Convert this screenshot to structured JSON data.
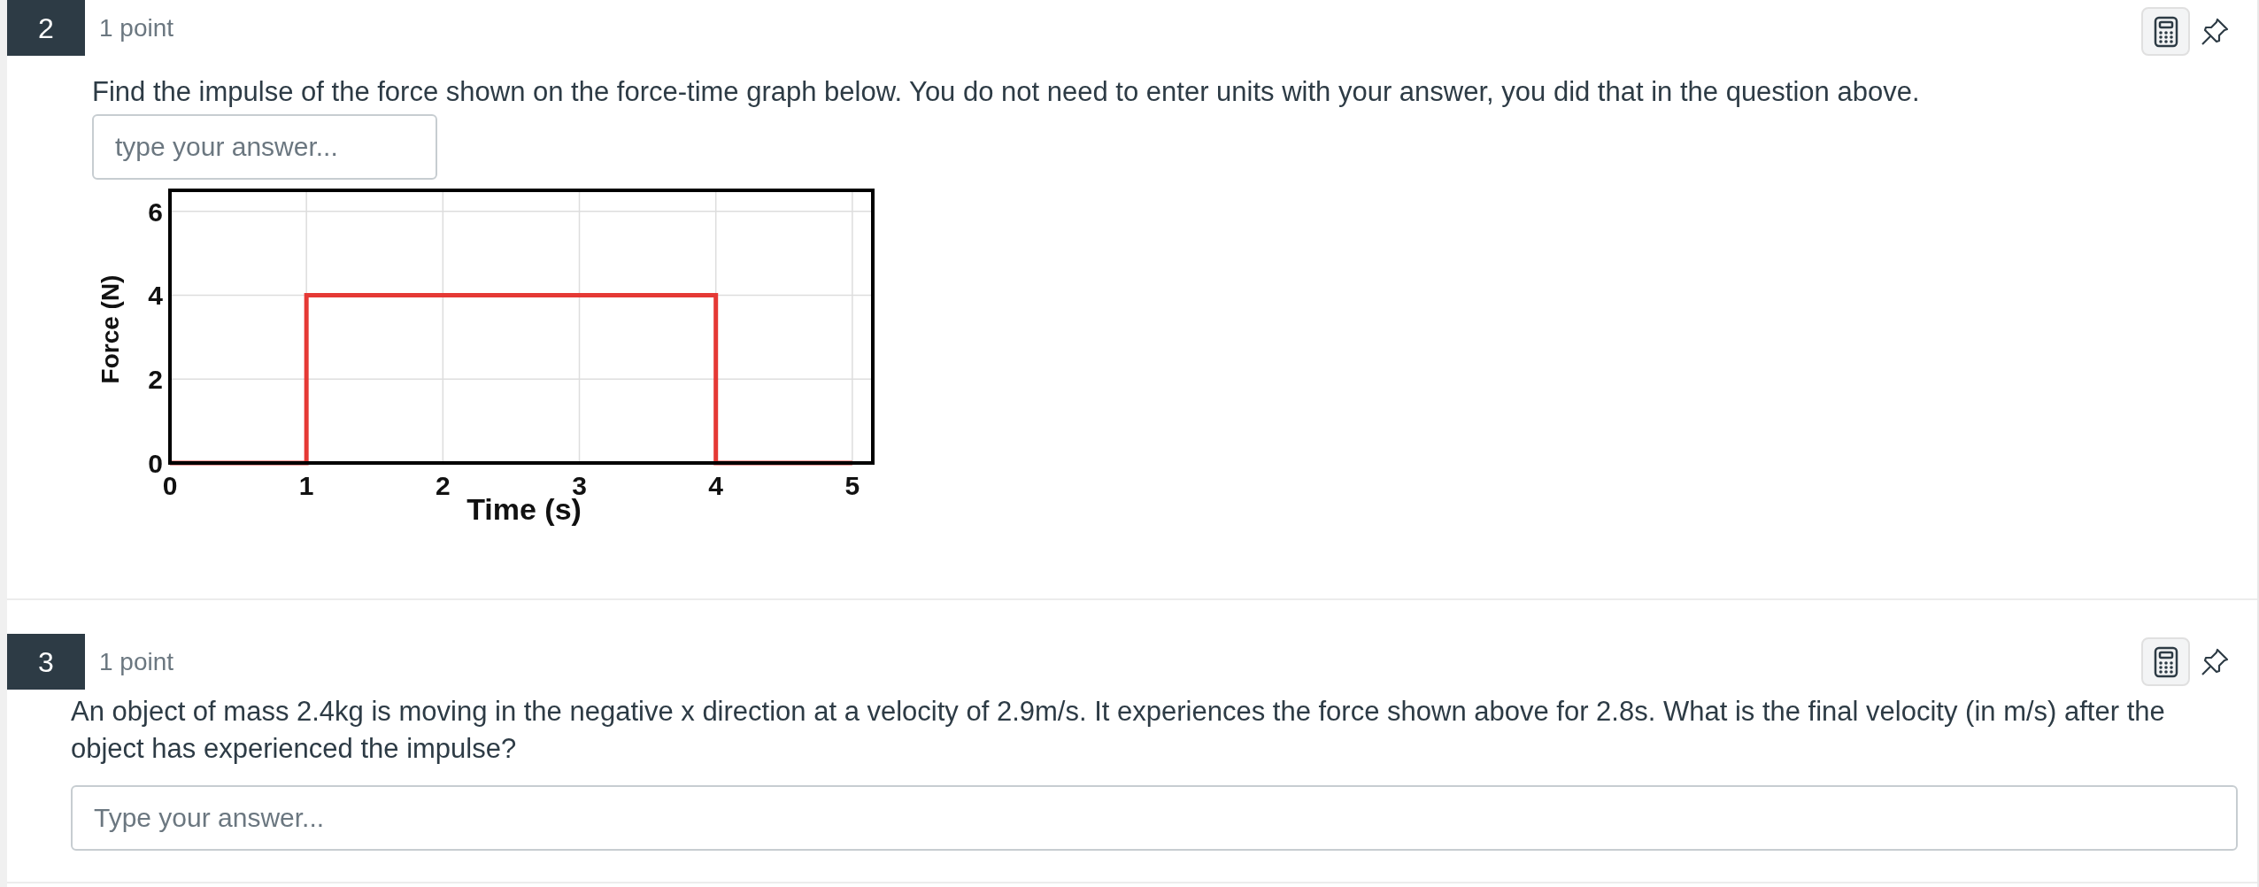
{
  "questions": [
    {
      "number": "2",
      "points": "1 point",
      "text": "Find the impulse of the force shown on the force-time graph below. You do not need to enter units with your answer, you did that in the question above.",
      "answer": {
        "placeholder": "type your answer..."
      },
      "chart_data": {
        "type": "line",
        "xlabel": "Time (s)",
        "ylabel": "Force (N)",
        "x": [
          0,
          1,
          1,
          4,
          4,
          5
        ],
        "grid": true,
        "series": [
          {
            "color": "#e53935",
            "values": [
              0,
              0,
              4,
              4,
              0,
              0
            ]
          }
        ],
        "xlim": [
          0,
          5.15
        ],
        "ylim": [
          0,
          6.5
        ],
        "xticks": [
          0,
          1,
          2,
          3,
          4,
          5
        ],
        "yticks": [
          0,
          2,
          4,
          6
        ]
      }
    },
    {
      "number": "3",
      "points": "1 point",
      "text": "An object of mass 2.4kg is moving in the negative x direction at a velocity of 2.9m/s. It experiences the force shown above for 2.8s. What is the final velocity (in m/s) after the object has experienced the impulse?",
      "answer": {
        "placeholder": "Type your answer..."
      }
    }
  ]
}
